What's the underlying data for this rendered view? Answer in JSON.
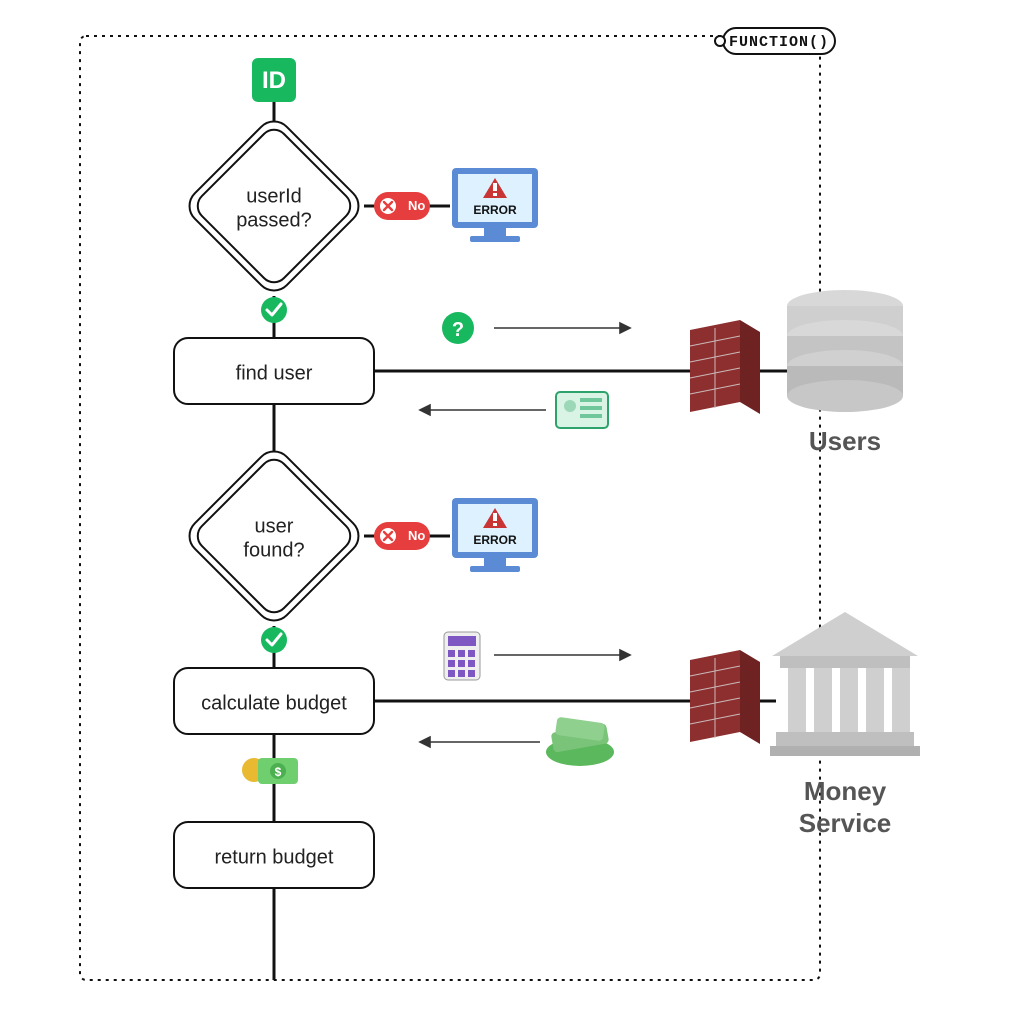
{
  "frame_label": "FUNCTION()",
  "start_badge": "ID",
  "decisions": {
    "d1_line1": "userId",
    "d1_line2": "passed?",
    "d2_line1": "user",
    "d2_line2": "found?"
  },
  "branch_no_label": "No",
  "steps": {
    "find_user": "find user",
    "calculate_budget": "calculate budget",
    "return_budget": "return budget"
  },
  "error_label": "ERROR",
  "external": {
    "users": "Users",
    "money_line1": "Money",
    "money_line2": "Service"
  },
  "chart_data": {
    "type": "flowchart",
    "title": "FUNCTION()",
    "nodes": [
      {
        "id": "start",
        "type": "start",
        "label": "ID"
      },
      {
        "id": "d1",
        "type": "decision",
        "label": "userId passed?"
      },
      {
        "id": "err1",
        "type": "terminator",
        "label": "ERROR"
      },
      {
        "id": "s1",
        "type": "process",
        "label": "find user"
      },
      {
        "id": "d2",
        "type": "decision",
        "label": "user found?"
      },
      {
        "id": "err2",
        "type": "terminator",
        "label": "ERROR"
      },
      {
        "id": "s2",
        "type": "process",
        "label": "calculate budget"
      },
      {
        "id": "s3",
        "type": "process",
        "label": "return budget"
      },
      {
        "id": "ext_users",
        "type": "external",
        "label": "Users"
      },
      {
        "id": "ext_money",
        "type": "external",
        "label": "Money Service"
      }
    ],
    "edges": [
      {
        "from": "start",
        "to": "d1"
      },
      {
        "from": "d1",
        "to": "err1",
        "label": "No"
      },
      {
        "from": "d1",
        "to": "s1",
        "label": "Yes"
      },
      {
        "from": "s1",
        "to": "ext_users",
        "label": "query",
        "direction": "both"
      },
      {
        "from": "s1",
        "to": "d2"
      },
      {
        "from": "d2",
        "to": "err2",
        "label": "No"
      },
      {
        "from": "d2",
        "to": "s2",
        "label": "Yes"
      },
      {
        "from": "s2",
        "to": "ext_money",
        "label": "calculate",
        "direction": "both"
      },
      {
        "from": "s2",
        "to": "s3",
        "label": "money"
      },
      {
        "from": "s3",
        "to": "end"
      }
    ]
  }
}
